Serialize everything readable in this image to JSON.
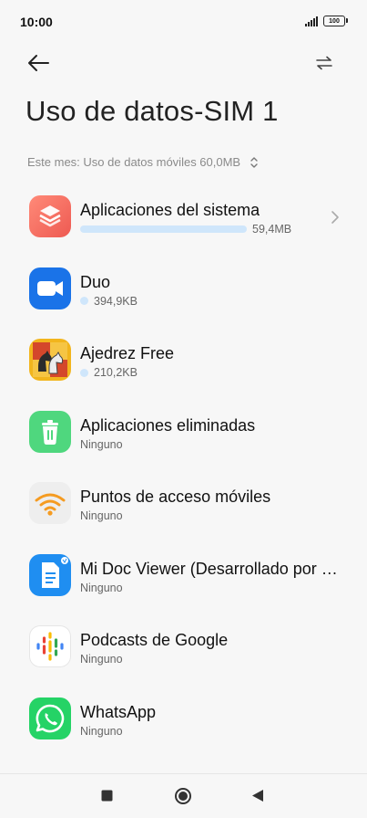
{
  "status": {
    "time": "10:00",
    "battery": "100"
  },
  "header": {
    "title": "Uso de datos-SIM 1"
  },
  "summary": {
    "month_text": "Este mes: Uso de datos móviles 60,0MB"
  },
  "apps": [
    {
      "name": "Aplicaciones del sistema",
      "usage": "59,4MB",
      "icon": "layers-icon",
      "color": "#f2685e"
    },
    {
      "name": "Duo",
      "usage": "394,9KB",
      "icon": "video-camera-icon",
      "color": "#1a73e8"
    },
    {
      "name": "Ajedrez Free",
      "usage": "210,2KB",
      "icon": "chess-icon",
      "color": "#c8862a"
    },
    {
      "name": "Aplicaciones eliminadas",
      "usage": "Ninguno",
      "icon": "trash-icon",
      "color": "#4fd77e"
    },
    {
      "name": "Puntos de acceso móviles",
      "usage": "Ninguno",
      "icon": "wifi-hotspot-icon",
      "color": "#f59b21"
    },
    {
      "name": "Mi Doc Viewer (Desarrollado por WPS Office)",
      "usage": "Ninguno",
      "icon": "document-icon",
      "color": "#1f8ef1"
    },
    {
      "name": "Podcasts de Google",
      "usage": "Ninguno",
      "icon": "podcasts-icon",
      "color": "#ffffff"
    },
    {
      "name": "WhatsApp",
      "usage": "Ninguno",
      "icon": "whatsapp-icon",
      "color": "#25d366"
    }
  ]
}
